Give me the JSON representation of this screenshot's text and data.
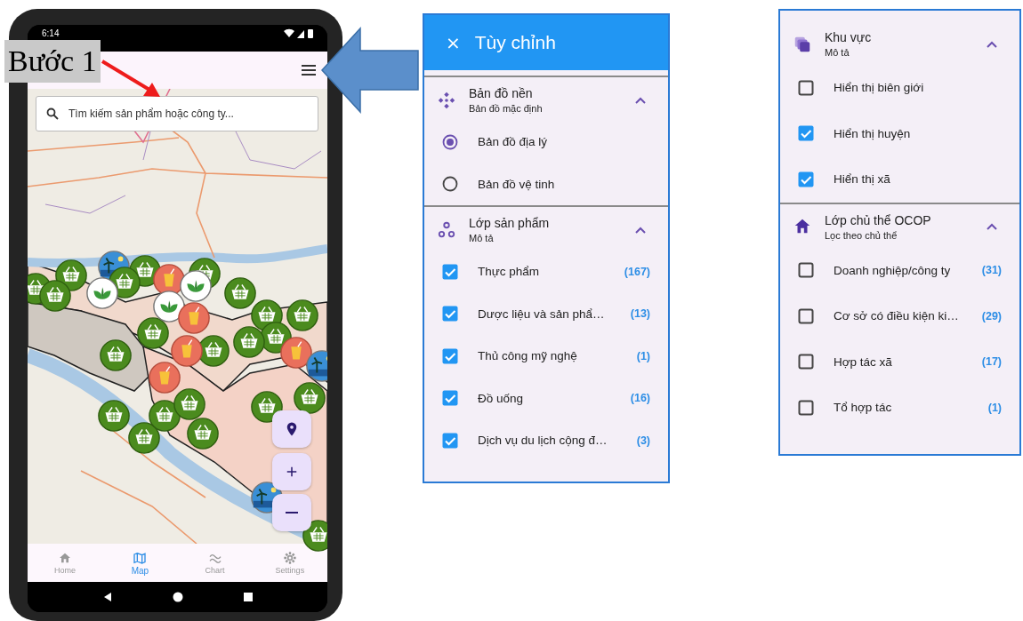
{
  "annotation": {
    "label": "Bước 1"
  },
  "phone": {
    "status_bar": {
      "time": "6:14"
    },
    "search": {
      "placeholder": "Tìm kiếm sản phẩm hoặc công ty..."
    },
    "bottom_nav": [
      {
        "label": "Home",
        "selected": false
      },
      {
        "label": "Map",
        "selected": true
      },
      {
        "label": "Chart",
        "selected": false
      },
      {
        "label": "Settings",
        "selected": false
      }
    ]
  },
  "settings_panels": [
    {
      "close": "×",
      "title": "Tùy chỉnh",
      "sections": [
        {
          "title": "Bản đồ nền",
          "subtitle": "Bản đồ mặc định",
          "expanded": true,
          "items": [
            {
              "kind": "radio",
              "label": "Bản đồ địa lý",
              "selected": true
            },
            {
              "kind": "radio",
              "label": "Bản đồ vệ tinh",
              "selected": false
            }
          ]
        },
        {
          "title": "Lớp sản phẩm",
          "subtitle": "Mô tả",
          "expanded": true,
          "items": [
            {
              "kind": "checkbox",
              "label": "Thực phẩm",
              "checked": true,
              "count": "(167)"
            },
            {
              "kind": "checkbox",
              "label": "Dược liệu và sản phẩ…",
              "checked": true,
              "count": "(13)"
            },
            {
              "kind": "checkbox",
              "label": "Thủ công mỹ nghệ",
              "checked": true,
              "count": "(1)"
            },
            {
              "kind": "checkbox",
              "label": "Đồ uống",
              "checked": true,
              "count": "(16)"
            },
            {
              "kind": "checkbox",
              "label": "Dịch vụ du lịch cộng đ…",
              "checked": true,
              "count": "(3)"
            }
          ]
        }
      ]
    },
    {
      "sections": [
        {
          "title": "Khu vực",
          "subtitle": "Mô tả",
          "expanded": true,
          "items": [
            {
              "kind": "checkbox",
              "label": "Hiển thị biên giới",
              "checked": false
            },
            {
              "kind": "checkbox",
              "label": "Hiển thị huyện",
              "checked": true
            },
            {
              "kind": "checkbox",
              "label": "Hiển thị xã",
              "checked": true
            }
          ]
        },
        {
          "title": "Lớp chủ thể OCOP",
          "subtitle": "Lọc theo chủ thể",
          "expanded": true,
          "items": [
            {
              "kind": "checkbox",
              "label": "Doanh nghiệp/công ty",
              "checked": false,
              "count": "(31)"
            },
            {
              "kind": "checkbox",
              "label": "Cơ sở có điều kiện ki…",
              "checked": false,
              "count": "(29)"
            },
            {
              "kind": "checkbox",
              "label": "Hợp tác xã",
              "checked": false,
              "count": "(17)"
            },
            {
              "kind": "checkbox",
              "label": "Tổ hợp tác",
              "checked": false,
              "count": "(1)"
            }
          ]
        }
      ]
    }
  ]
}
